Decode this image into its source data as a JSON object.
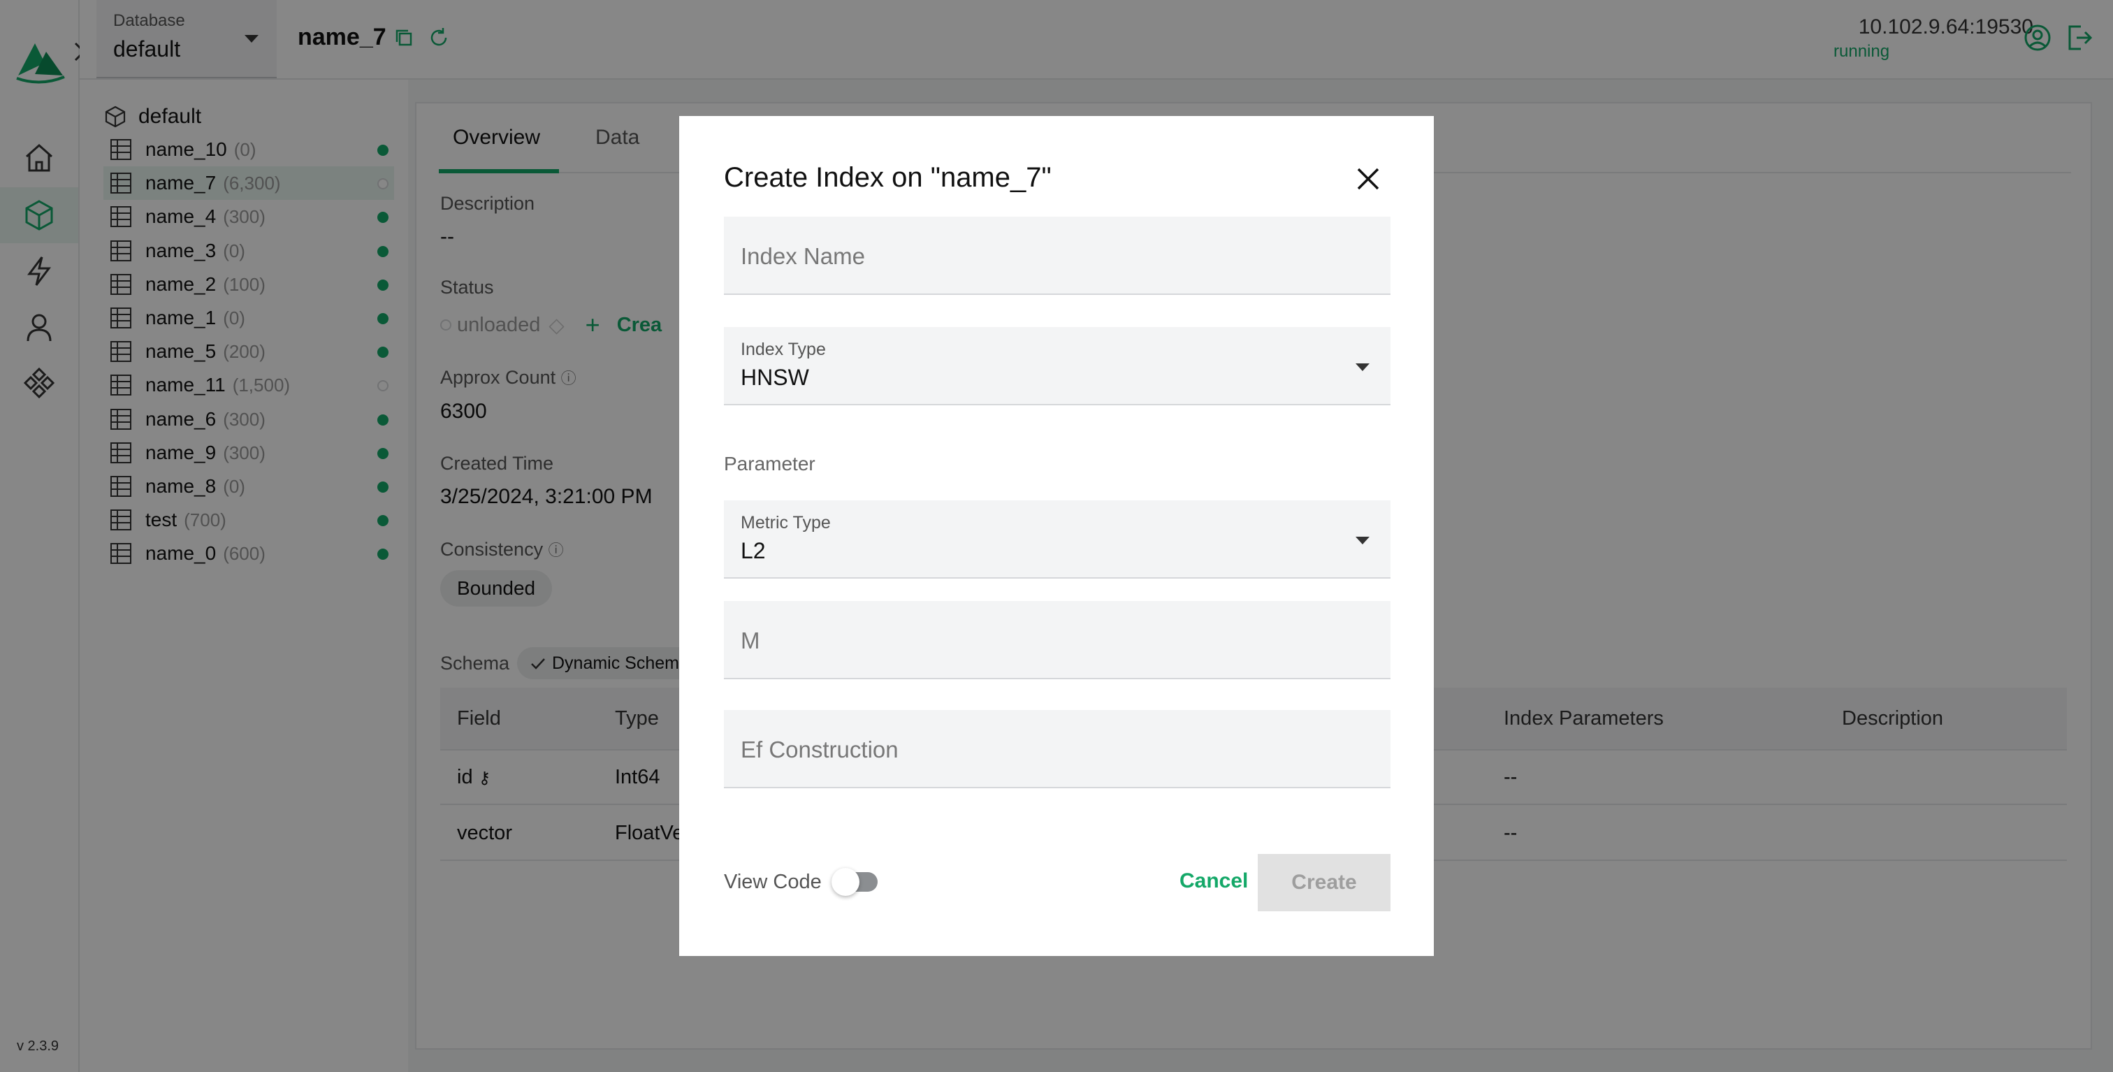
{
  "app": {
    "version": "v 2.3.9"
  },
  "header": {
    "db_label": "Database",
    "db_value": "default",
    "collection_title": "name_7",
    "server_address": "10.102.9.64:19530",
    "server_status": "running"
  },
  "tree": {
    "root": "default",
    "items": [
      {
        "name": "name_10",
        "count": "(0)",
        "loaded": true
      },
      {
        "name": "name_7",
        "count": "(6,300)",
        "loaded": false,
        "active": true
      },
      {
        "name": "name_4",
        "count": "(300)",
        "loaded": true
      },
      {
        "name": "name_3",
        "count": "(0)",
        "loaded": true
      },
      {
        "name": "name_2",
        "count": "(100)",
        "loaded": true
      },
      {
        "name": "name_1",
        "count": "(0)",
        "loaded": true
      },
      {
        "name": "name_5",
        "count": "(200)",
        "loaded": true
      },
      {
        "name": "name_11",
        "count": "(1,500)",
        "loaded": false
      },
      {
        "name": "name_6",
        "count": "(300)",
        "loaded": true
      },
      {
        "name": "name_9",
        "count": "(300)",
        "loaded": true
      },
      {
        "name": "name_8",
        "count": "(0)",
        "loaded": true
      },
      {
        "name": "test",
        "count": "(700)",
        "loaded": true
      },
      {
        "name": "name_0",
        "count": "(600)",
        "loaded": true
      }
    ]
  },
  "main": {
    "tabs": [
      "Overview",
      "Data"
    ],
    "description_label": "Description",
    "description_value": "--",
    "status_label": "Status",
    "status_value": "unloaded",
    "status_action": "Crea",
    "approx_label": "Approx Count",
    "approx_value": "6300",
    "created_label": "Created Time",
    "created_value": "3/25/2024, 3:21:00 PM",
    "consistency_label": "Consistency",
    "consistency_value": "Bounded",
    "schema_label": "Schema",
    "dynamic_schema": "Dynamic Schema",
    "table": {
      "headers": [
        "Field",
        "Type",
        "Index Parameters",
        "Description"
      ],
      "rows": [
        {
          "field": "id",
          "type": "Int64",
          "index_params": "--"
        },
        {
          "field": "vector",
          "type": "FloatVe",
          "index_params": "--"
        }
      ]
    }
  },
  "modal": {
    "title": "Create Index on \"name_7\"",
    "index_name_placeholder": "Index Name",
    "index_type_label": "Index Type",
    "index_type_value": "HNSW",
    "parameter_label": "Parameter",
    "metric_type_label": "Metric Type",
    "metric_type_value": "L2",
    "m_placeholder": "M",
    "ef_placeholder": "Ef Construction",
    "view_code_label": "View Code",
    "cancel_label": "Cancel",
    "create_label": "Create"
  },
  "colors": {
    "accent": "#14a868",
    "overlay": "rgba(0,0,0,0.47)"
  }
}
